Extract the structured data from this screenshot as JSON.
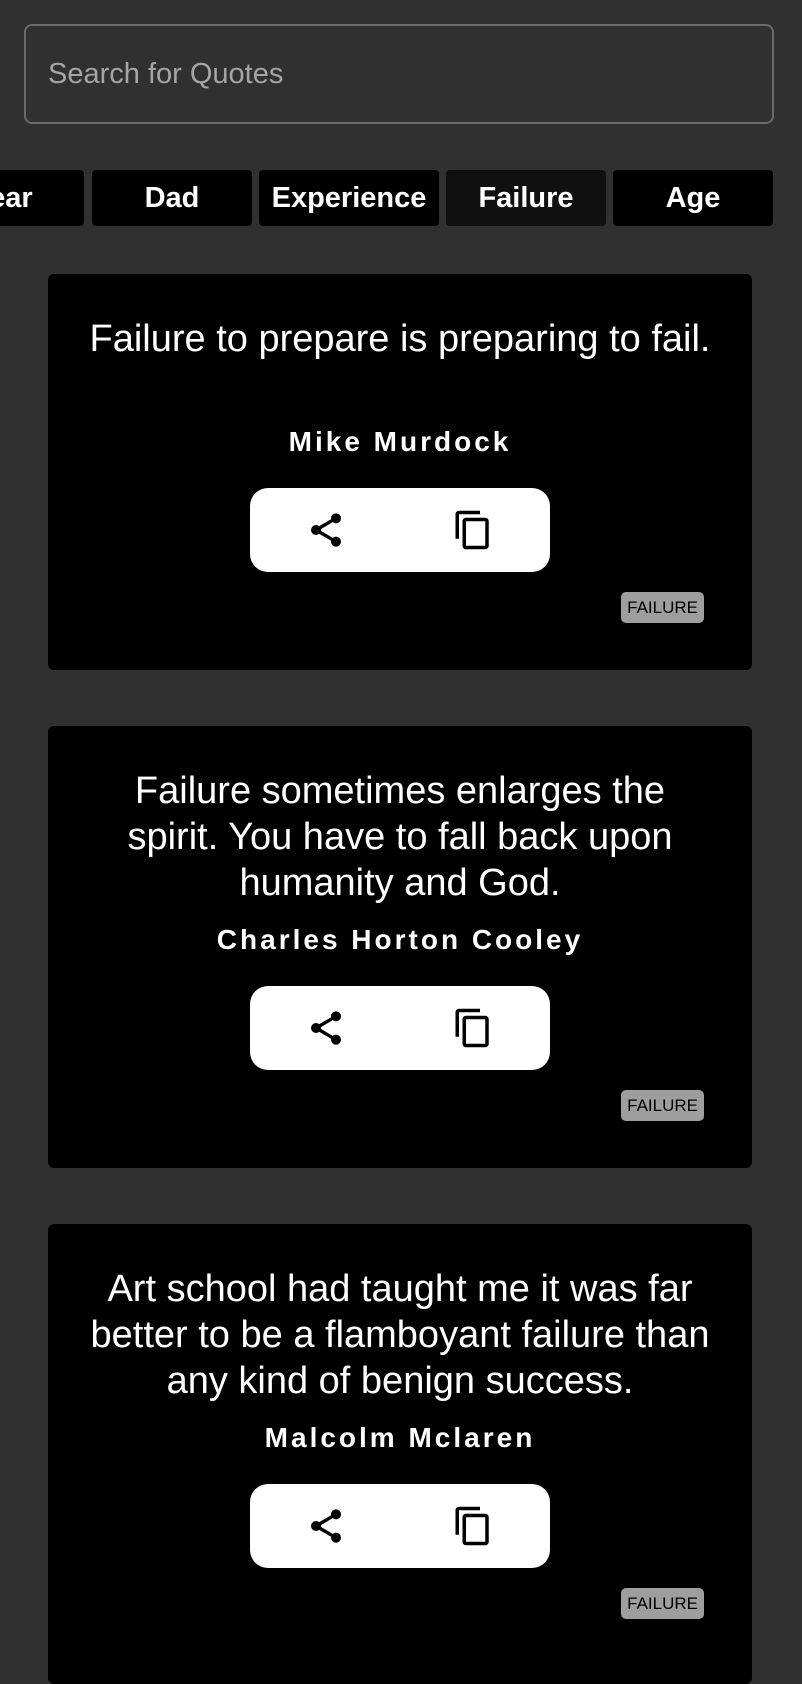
{
  "search": {
    "placeholder": "Search for Quotes",
    "value": ""
  },
  "categories": [
    {
      "label": "Fear"
    },
    {
      "label": "Dad"
    },
    {
      "label": "Experience"
    },
    {
      "label": "Failure",
      "selected": true
    },
    {
      "label": "Age"
    }
  ],
  "quotes": [
    {
      "text": "Failure to prepare is preparing to fail.",
      "author": "Mike Murdock",
      "tag": "FAILURE",
      "actions": {
        "share_icon": "share-icon",
        "copy_icon": "copy-icon"
      }
    },
    {
      "text": "Failure sometimes enlarges the spirit. You have to fall back upon humanity and God.",
      "author": "Charles Horton Cooley",
      "tag": "FAILURE",
      "actions": {
        "share_icon": "share-icon",
        "copy_icon": "copy-icon"
      }
    },
    {
      "text": "Art school had taught me it was far better to be a flamboyant failure than any kind of benign success.",
      "author": "Malcolm Mclaren",
      "tag": "FAILURE",
      "actions": {
        "share_icon": "share-icon",
        "copy_icon": "copy-icon"
      }
    }
  ],
  "colors": {
    "background": "#303030",
    "card": "#000000",
    "tag_background": "#9e9e9e",
    "action_bar": "#ffffff"
  }
}
